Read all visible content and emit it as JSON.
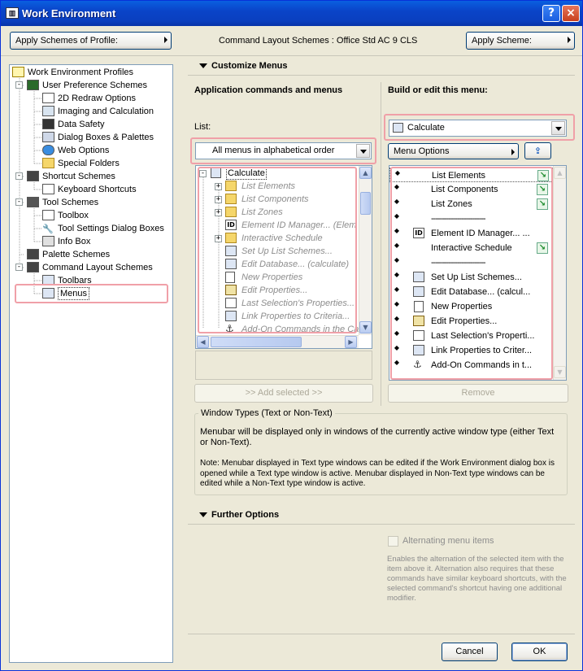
{
  "window": {
    "title": "Work Environment",
    "help_glyph": "?",
    "close_glyph": "×"
  },
  "header": {
    "apply_profile_label": "Apply Schemes of Profile:",
    "scheme_caption": "Command Layout Schemes : Office Std AC 9 CLS",
    "apply_scheme_label": "Apply Scheme:"
  },
  "tree": {
    "items": [
      {
        "label": "Work Environment Profiles"
      },
      {
        "label": "User Preference Schemes",
        "toggle": "-"
      },
      {
        "label": "2D Redraw Options"
      },
      {
        "label": "Imaging and Calculation"
      },
      {
        "label": "Data Safety"
      },
      {
        "label": "Dialog Boxes & Palettes"
      },
      {
        "label": "Web Options"
      },
      {
        "label": "Special Folders"
      },
      {
        "label": "Shortcut Schemes",
        "toggle": "-"
      },
      {
        "label": "Keyboard Shortcuts"
      },
      {
        "label": "Tool Schemes",
        "toggle": "-"
      },
      {
        "label": "Toolbox"
      },
      {
        "label": "Tool Settings Dialog Boxes"
      },
      {
        "label": "Info Box"
      },
      {
        "label": "Palette Schemes"
      },
      {
        "label": "Command Layout Schemes",
        "toggle": "-"
      },
      {
        "label": "Toolbars"
      },
      {
        "label": "Menus"
      }
    ]
  },
  "customize": {
    "section_title": "Customize Menus",
    "left_heading": "Application commands and menus",
    "right_heading": "Build or edit this menu:",
    "list_label": "List:",
    "list_combo_value": "All menus in alphabetical order",
    "menu_combo_value": "Calculate",
    "menu_options_label": "Menu Options",
    "root_toggle": "-",
    "child_toggle": "+",
    "command_tree": [
      {
        "label": "Calculate"
      },
      {
        "label": "List Elements"
      },
      {
        "label": "List Components"
      },
      {
        "label": "List Zones"
      },
      {
        "label": "Element ID Manager... (Elem"
      },
      {
        "label": "Interactive Schedule"
      },
      {
        "label": "Set Up List Schemes..."
      },
      {
        "label": "Edit Database... (calculate)"
      },
      {
        "label": "New Properties"
      },
      {
        "label": "Edit Properties..."
      },
      {
        "label": "Last Selection's Properties..."
      },
      {
        "label": "Link Properties to Criteria..."
      },
      {
        "label": "Add-On Commands in the Ca"
      }
    ],
    "menu_items": [
      {
        "label": "List Elements"
      },
      {
        "label": "List Components"
      },
      {
        "label": "List Zones"
      },
      {
        "label": "-------------------------"
      },
      {
        "label": "Element ID Manager... ..."
      },
      {
        "label": "Interactive Schedule"
      },
      {
        "label": "-------------------------"
      },
      {
        "label": "Set Up List Schemes..."
      },
      {
        "label": "Edit Database... (calcul..."
      },
      {
        "label": "New Properties"
      },
      {
        "label": "Edit Properties..."
      },
      {
        "label": "Last Selection's Properti..."
      },
      {
        "label": "Link Properties to Criter..."
      },
      {
        "label": "Add-On Commands in t..."
      }
    ],
    "add_selected_label": ">> Add selected >>",
    "remove_label": "Remove",
    "icon_id_text": "ID",
    "scroll_up": "▲",
    "scroll_down": "▼",
    "scroll_left": "◀",
    "scroll_right": "▶",
    "grip": "◆"
  },
  "window_types": {
    "group_title": "Window Types (Text or Non-Text)",
    "line1": "Menubar will be displayed only in windows of the currently active window type (either Text or Non-Text).",
    "note": "Note: Menubar displayed in Text type windows can be edited if the Work Environment dialog box is opened while a Text type window is active. Menubar displayed in Non-Text type windows can be edited while a Non-Text type window is active."
  },
  "further": {
    "section_title": "Further Options",
    "alternating_label": "Alternating menu items",
    "alternating_desc": "Enables the alternation of the selected item with the item above it. Alternation also requires that these commands have similar keyboard shortcuts, with the selected command's shortcut having one additional modifier."
  },
  "footer": {
    "cancel_label": "Cancel",
    "ok_label": "OK"
  }
}
